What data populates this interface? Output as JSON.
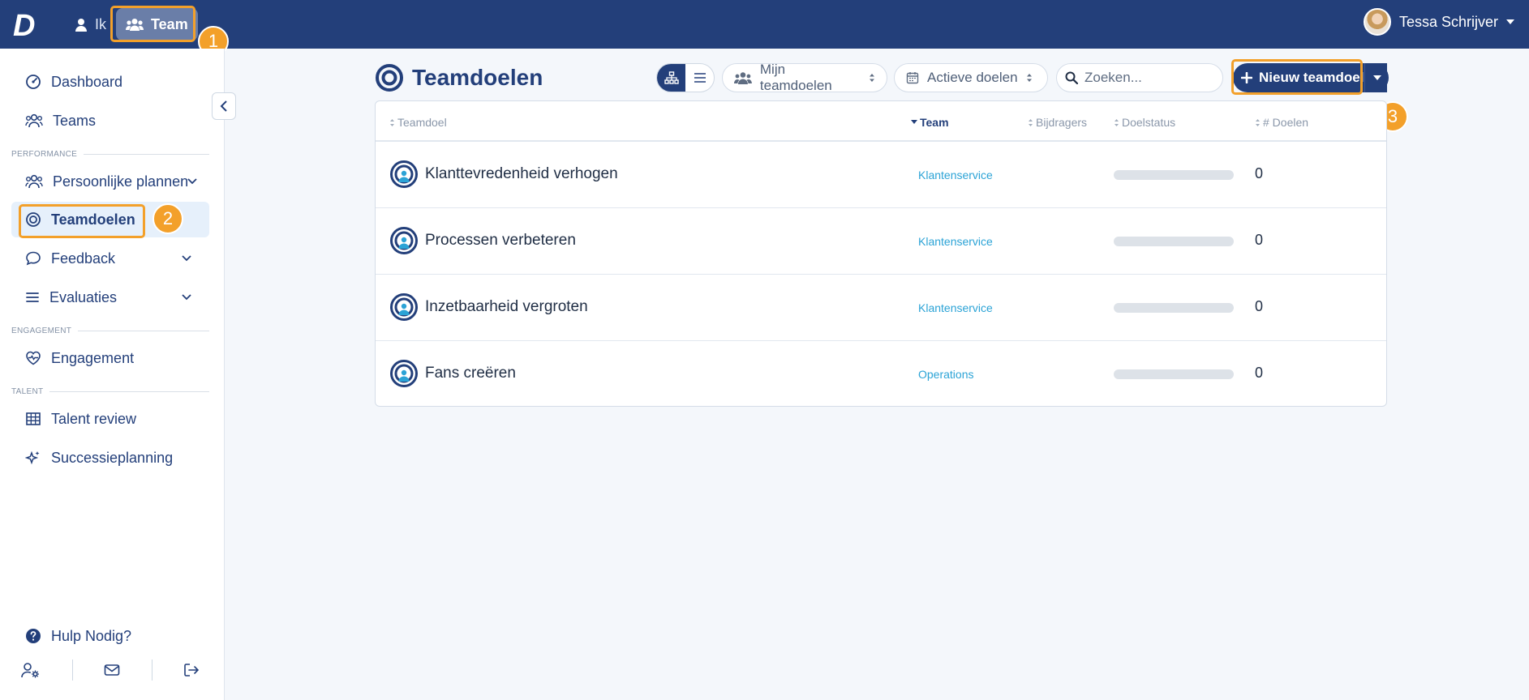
{
  "app": {
    "logo_letter": "D",
    "brand_color": "#233f7a",
    "accent_color": "#f3a02a"
  },
  "topnav": {
    "items": [
      {
        "label": "Ik",
        "icon": "user-icon",
        "active": false
      },
      {
        "label": "Team",
        "icon": "users-icon",
        "active": true
      }
    ],
    "user_name": "Tessa Schrijver"
  },
  "sidebar": {
    "items": [
      {
        "label": "Dashboard",
        "icon": "dashboard-gauge-icon"
      },
      {
        "label": "Teams",
        "icon": "users-icon"
      }
    ],
    "performance_section": "PERFORMANCE",
    "performance_items": [
      {
        "label": "Persoonlijke plannen",
        "icon": "users-icon",
        "has_chevron": true
      },
      {
        "label": "Teamdoelen",
        "icon": "target-icon",
        "active": true
      },
      {
        "label": "Feedback",
        "icon": "chat-bubble-icon",
        "has_chevron": true
      },
      {
        "label": "Evaluaties",
        "icon": "list-icon",
        "has_chevron": true
      }
    ],
    "engagement_section": "ENGAGEMENT",
    "engagement_items": [
      {
        "label": "Engagement",
        "icon": "heart-pulse-icon"
      }
    ],
    "talent_section": "TALENT",
    "talent_items": [
      {
        "label": "Talent review",
        "icon": "grid-table-icon"
      },
      {
        "label": "Successieplanning",
        "icon": "sparkles-icon"
      }
    ],
    "help_label": "Hulp Nodig?"
  },
  "main": {
    "title": "Teamdoelen",
    "filters": {
      "scope": "Mijn teamdoelen",
      "status": "Actieve doelen"
    },
    "search_placeholder": "Zoeken...",
    "new_button_label": "Nieuw teamdoel",
    "table": {
      "columns": [
        "Teamdoel",
        "Team",
        "Bijdragers",
        "Doelstatus",
        "# Doelen"
      ],
      "sorted_column": "Team",
      "rows": [
        {
          "goal": "Klanttevredenheid verhogen",
          "team": "Klantenservice",
          "progress": 0,
          "count": "0"
        },
        {
          "goal": "Processen verbeteren",
          "team": "Klantenservice",
          "progress": 0,
          "count": "0"
        },
        {
          "goal": "Inzetbaarheid vergroten",
          "team": "Klantenservice",
          "progress": 0,
          "count": "0"
        },
        {
          "goal": "Fans creëren",
          "team": "Operations",
          "progress": 0,
          "count": "0"
        }
      ]
    }
  },
  "annotations": [
    "1",
    "2",
    "3"
  ]
}
